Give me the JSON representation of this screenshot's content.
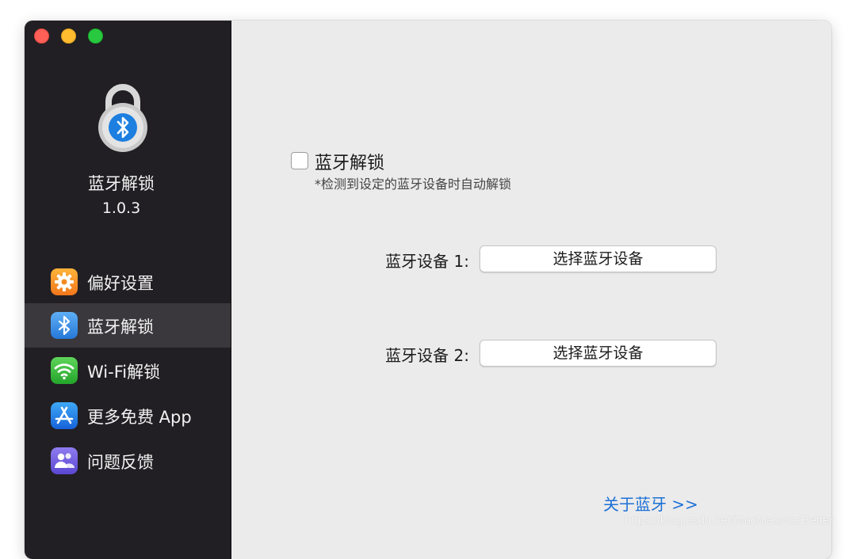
{
  "app": {
    "name": "蓝牙解锁",
    "version": "1.0.3"
  },
  "sidebar": {
    "items": [
      {
        "label": "偏好设置",
        "icon": "gear-icon",
        "active": false
      },
      {
        "label": "蓝牙解锁",
        "icon": "bluetooth-icon",
        "active": true
      },
      {
        "label": "Wi-Fi解锁",
        "icon": "wifi-icon",
        "active": false
      },
      {
        "label": "更多免费 App",
        "icon": "app-store-icon",
        "active": false
      },
      {
        "label": "问题反馈",
        "icon": "feedback-icon",
        "active": false
      }
    ]
  },
  "main": {
    "toggle_label": "蓝牙解锁",
    "toggle_checked": false,
    "toggle_description": "*检测到设定的蓝牙设备时自动解锁",
    "devices": [
      {
        "label": "蓝牙设备 1:",
        "button": "选择蓝牙设备"
      },
      {
        "label": "蓝牙设备 2:",
        "button": "选择蓝牙设备"
      }
    ],
    "about_link": "关于蓝牙 >>"
  },
  "watermark": "https://blog.csdn.net/MacMacMacBetter",
  "colors": {
    "sidebar_bg": "#211f23",
    "active_item_bg": "#3a383c",
    "content_bg": "#ebebeb",
    "link": "#1b70d6"
  }
}
